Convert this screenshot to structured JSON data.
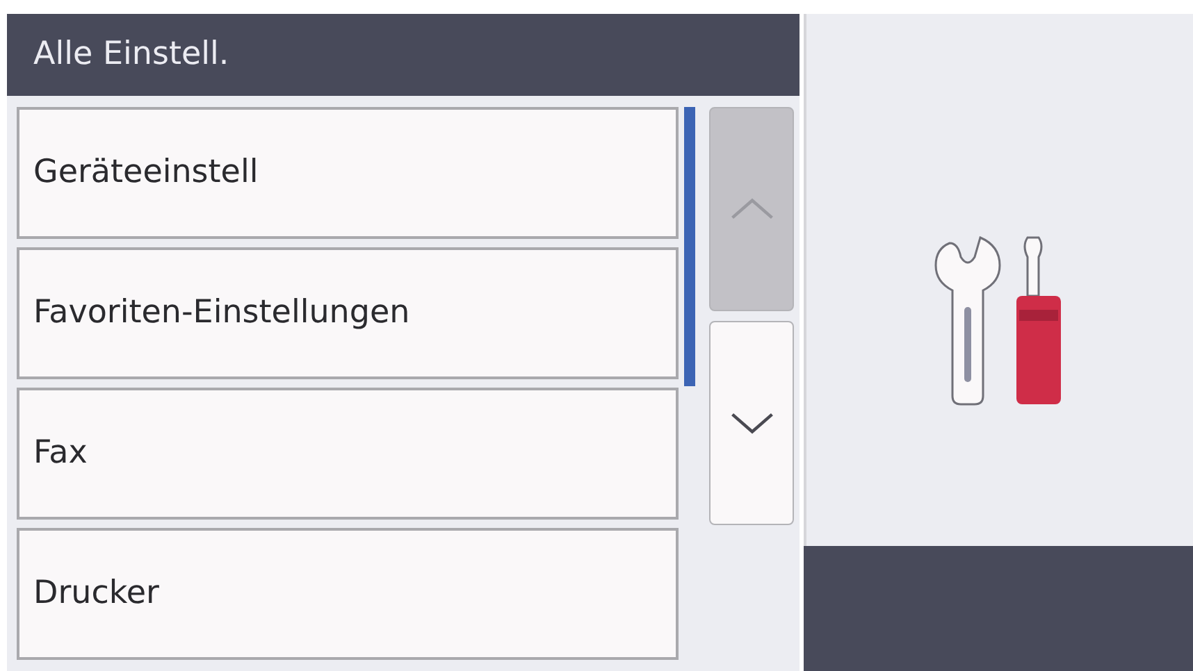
{
  "header": {
    "title": "Alle Einstell."
  },
  "menu_items": [
    {
      "label": "Geräteeinstell"
    },
    {
      "label": "Favoriten-Einstellungen"
    },
    {
      "label": "Fax"
    },
    {
      "label": "Drucker"
    }
  ],
  "scroll_buttons": [
    {
      "kind": "up",
      "disabled": true
    },
    {
      "kind": "down",
      "disabled": false
    }
  ]
}
